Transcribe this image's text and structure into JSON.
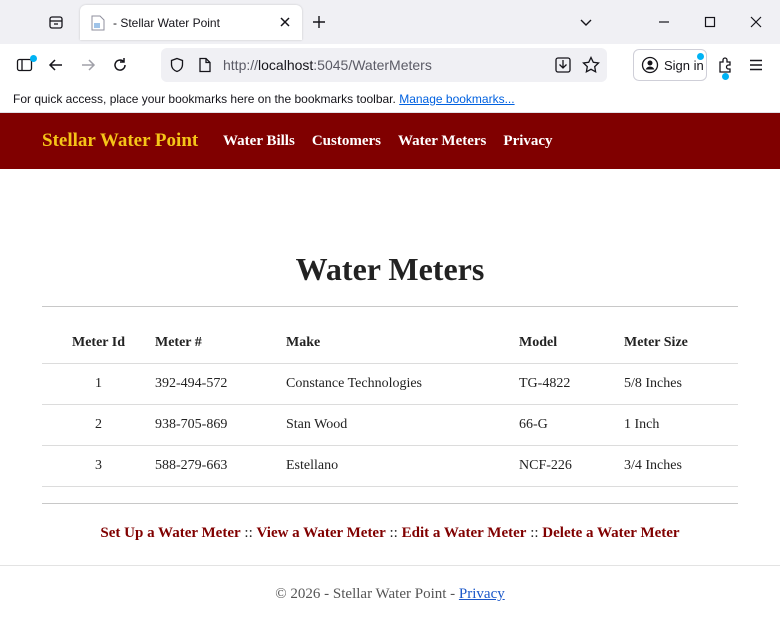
{
  "browser": {
    "tab_title": "- Stellar Water Point",
    "url_prefix": "http://",
    "url_host": "localhost",
    "url_rest": ":5045/WaterMeters",
    "signin_label": "Sign in",
    "bookmarks_text": "For quick access, place your bookmarks here on the bookmarks toolbar.",
    "bookmarks_link": "Manage bookmarks...",
    "accent_color": "#00b3f4"
  },
  "site": {
    "brand": "Stellar Water Point",
    "header_color": "#800000",
    "brand_color": "#f5c518",
    "nav": [
      "Water Bills",
      "Customers",
      "Water Meters",
      "Privacy"
    ]
  },
  "page": {
    "title": "Water Meters",
    "columns": [
      "Meter Id",
      "Meter #",
      "Make",
      "Model",
      "Meter Size"
    ],
    "rows": [
      [
        "1",
        "392-494-572",
        "Constance Technologies",
        "TG-4822",
        "5/8 Inches"
      ],
      [
        "2",
        "938-705-869",
        "Stan Wood",
        "66-G",
        "1 Inch"
      ],
      [
        "3",
        "588-279-663",
        "Estellano",
        "NCF-226",
        "3/4 Inches"
      ]
    ],
    "actions": [
      "Set Up a Water Meter",
      "View a Water Meter",
      "Edit a Water Meter",
      "Delete a Water Meter"
    ],
    "action_separator": "::"
  },
  "footer": {
    "text": "© 2026 - Stellar Water Point - ",
    "link": "Privacy"
  }
}
